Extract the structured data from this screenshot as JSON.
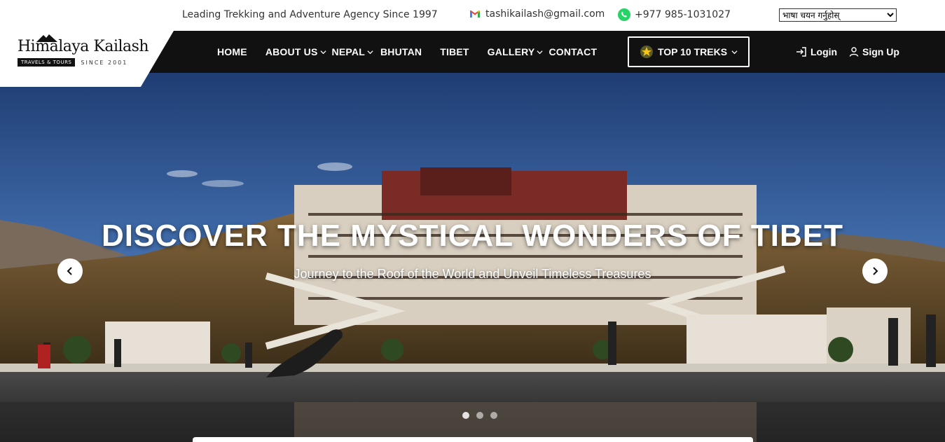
{
  "topbar": {
    "tagline": "Leading Trekking and Adventure Agency Since 1997",
    "email": "tashikailash@gmail.com",
    "phone": "+977 985-1031027",
    "language_select": "भाषा चयन गर्नुहोस्"
  },
  "logo": {
    "title": "Himalaya Kailash",
    "badge": "TRAVELS & TOURS",
    "since": "SINCE 2001"
  },
  "nav": {
    "home": "HOME",
    "about": "ABOUT US",
    "nepal": "NEPAL",
    "bhutan": "BHUTAN",
    "tibet": "TIBET",
    "gallery": "GALLERY",
    "contact": "CONTACT",
    "top_treks": "TOP 10 TREKS",
    "login": "Login",
    "signup": "Sign Up"
  },
  "hero": {
    "title": "DISCOVER THE MYSTICAL WONDERS OF TIBET",
    "subtitle": "Journey to the Roof of the World and Unveil Timeless Treasures",
    "slide_count": 3,
    "active_slide": 1
  },
  "colors": {
    "nav_bg": "#111111",
    "email_icon": "#ea4335",
    "whatsapp": "#25d366"
  }
}
